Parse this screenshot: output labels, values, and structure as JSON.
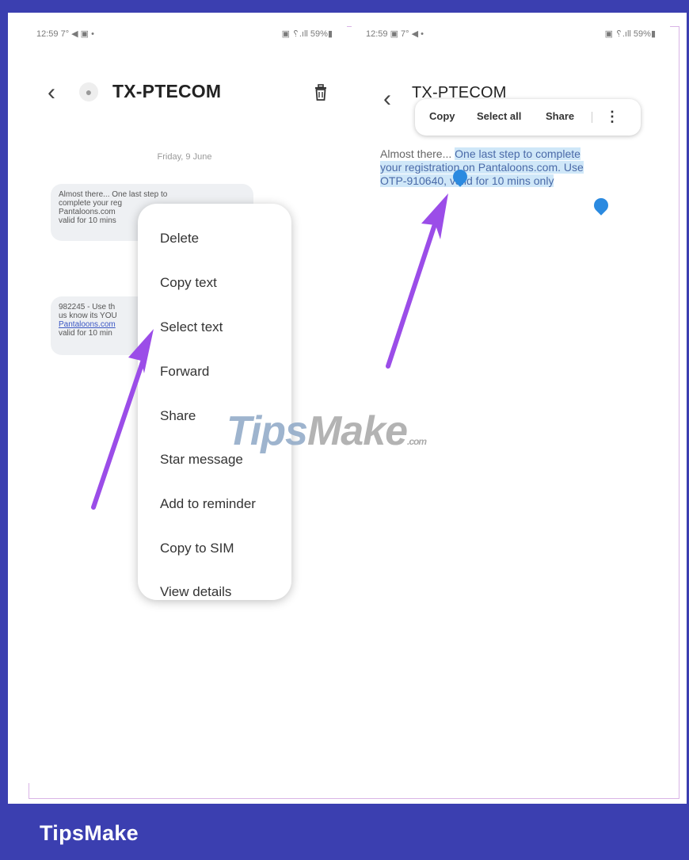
{
  "colors": {
    "frame": "#3b3fb0",
    "arrow": "#9b4de8",
    "selection": "#cfe7f8",
    "handle": "#2b8ae0"
  },
  "left_screen": {
    "status_left": "12:59 7° ◀ ▣ •",
    "status_right": "▣ ␦.ıll 59%▮",
    "back_icon": "chevron-left-icon",
    "avatar_icon": "person-icon",
    "title": "TX-PTECOM",
    "trash_icon": "trash-icon",
    "date": "Friday, 9 June",
    "message1": {
      "line1": "Almost there... One last step to",
      "line2": "complete your reg",
      "line3": "Pantaloons.com",
      "line4": "valid for 10 mins"
    },
    "message2": {
      "line1": "982245 - Use th",
      "line2": "us know its YOU",
      "line3": "Pantaloons.com",
      "line4": "valid for 10 min"
    },
    "menu": [
      "Delete",
      "Copy text",
      "Select text",
      "Forward",
      "Share",
      "Star message",
      "Add to reminder",
      "Copy to SIM",
      "View details"
    ]
  },
  "right_screen": {
    "status_left": "12:59 ▣ 7° ◀ •",
    "status_right": "▣ ␦.ıll 59%▮",
    "back_icon": "chevron-left-icon",
    "title": "TX-PTECOM",
    "toolbar": {
      "copy": "Copy",
      "select_all": "Select all",
      "share": "Share",
      "more_icon": "more-vertical-icon"
    },
    "message": {
      "plain": "Almost there... ",
      "selected1": "One last step to complete",
      "selected2": "your registration on Pantaloons.com. Use",
      "selected3": "OTP-910640, valid for 10 mins only"
    }
  },
  "watermark": {
    "tips": "Tips",
    "make": "Make",
    "com": ".com"
  },
  "footer": {
    "label": "TipsMake"
  }
}
